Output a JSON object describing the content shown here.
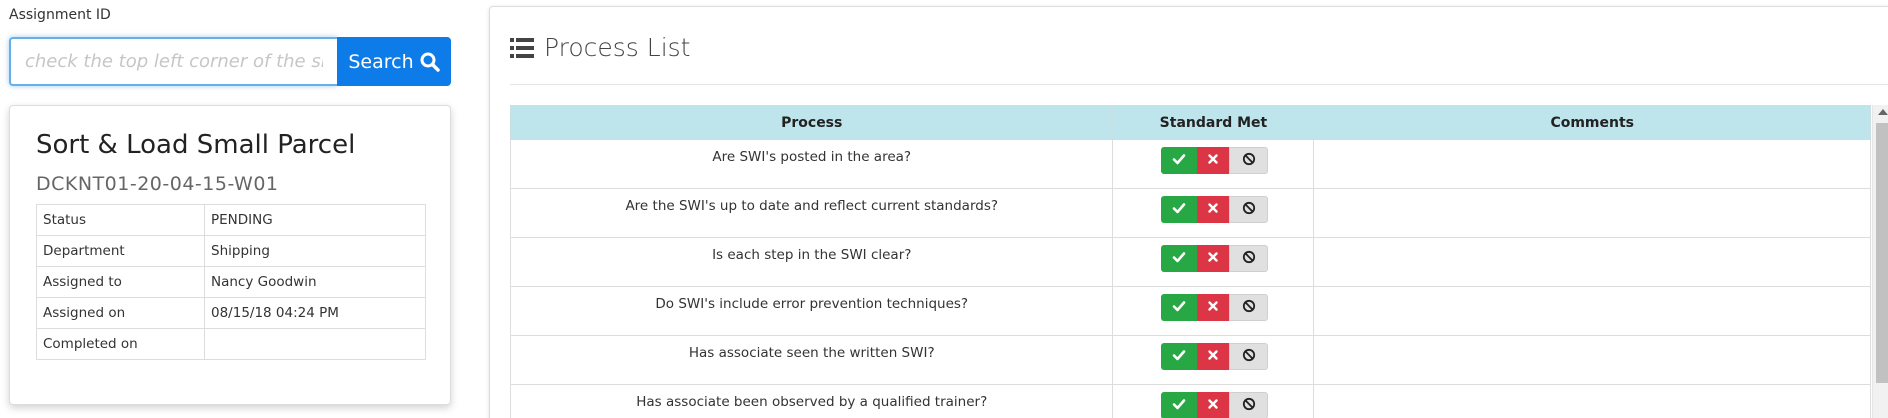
{
  "assignment": {
    "label": "Assignment ID",
    "placeholder": "check the top left corner of the sheet",
    "value": "",
    "search_label": "Search"
  },
  "card": {
    "title": "Sort & Load Small Parcel",
    "code": "DCKNT01-20-04-15-W01",
    "rows": [
      {
        "key": "Status",
        "value": "PENDING"
      },
      {
        "key": "Department",
        "value": "Shipping"
      },
      {
        "key": "Assigned to",
        "value": "Nancy Goodwin"
      },
      {
        "key": "Assigned on",
        "value": "08/15/18 04:24 PM"
      },
      {
        "key": "Completed on",
        "value": ""
      }
    ]
  },
  "process_list": {
    "title": "Process List",
    "columns": {
      "process": "Process",
      "standard": "Standard Met",
      "comments": "Comments"
    },
    "rows": [
      {
        "process": "Are SWI's posted in the area?",
        "comment": ""
      },
      {
        "process": "Are the SWI's up to date and reflect current standards?",
        "comment": ""
      },
      {
        "process": "Is each step in the SWI clear?",
        "comment": ""
      },
      {
        "process": "Do SWI's include error prevention techniques?",
        "comment": ""
      },
      {
        "process": "Has associate seen the written SWI?",
        "comment": ""
      },
      {
        "process": "Has associate been observed by a qualified trainer?",
        "comment": ""
      }
    ]
  },
  "colors": {
    "primary": "#0d7be8",
    "success": "#28a745",
    "danger": "#dc3545",
    "neutral": "#e0e0e0",
    "header_bg": "#bee5eb"
  },
  "icons": {
    "search": "search-icon",
    "list": "list-icon",
    "met": "check-icon",
    "not_met": "times-icon",
    "na": "ban-icon"
  }
}
